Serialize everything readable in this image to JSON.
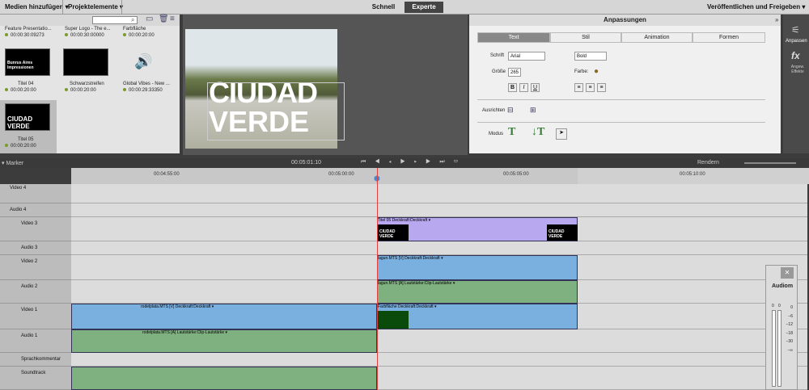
{
  "toolbar": {
    "add_media": "Medien hinzufügen",
    "project_items": "Projektelemente",
    "quick": "Schnell",
    "expert": "Experte",
    "publish": "Veröffentlichen und Freigeben"
  },
  "project": {
    "items": [
      {
        "name": "Feature Presentatio...",
        "time": "00:00:30:09273"
      },
      {
        "name": "Super Logo - The e...",
        "time": "00:00:30:00000"
      },
      {
        "name": "Farbfläche",
        "time": "00:00:20:00"
      },
      {
        "name": "Titel 04",
        "time": "00:00:20:00",
        "thumb_text": "Bunrus Aires Impressionen"
      },
      {
        "name": "Schwarzstreifen",
        "time": "00:00:20:00"
      },
      {
        "name": "Global Vibes - New ...",
        "time": "00:00:29:33350"
      },
      {
        "name": "Titel 05",
        "time": "00:00:20:00",
        "thumb_text": "CIUDAD VERDE"
      }
    ]
  },
  "monitor": {
    "title_line1": "CIUDAD",
    "title_line2": "VERDE"
  },
  "adjust": {
    "header": "Anpassungen",
    "tabs": [
      "Text",
      "Stil",
      "Animation",
      "Formen"
    ],
    "font_label": "Schrift",
    "font_value": "Arial",
    "style_value": "Bold",
    "size_label": "Größe",
    "size_value": "265",
    "color_label": "Farbe:",
    "bold": "B",
    "italic": "I",
    "underline": "U",
    "align_label": "Ausrichten",
    "mode_label": "Modus"
  },
  "rightpanel": {
    "adjust": "Anpassen",
    "effects": "Angew. Effekte"
  },
  "timeline": {
    "marker": "Marker",
    "timecode": "00:05:01:10",
    "render": "Rendern",
    "ticks": [
      "00:04:55:00",
      "00:05:00:00",
      "00:05:05:00",
      "00:05:10:00"
    ]
  },
  "tracks": [
    {
      "name": "Video 4"
    },
    {
      "name": "Audio 4"
    },
    {
      "name": "Video 3"
    },
    {
      "name": "Audio 3"
    },
    {
      "name": "Video 2"
    },
    {
      "name": "Audio 2"
    },
    {
      "name": "Video 1"
    },
    {
      "name": "Audio 1"
    },
    {
      "name": "Sprachkommentar"
    },
    {
      "name": "Soundtrack"
    }
  ],
  "clips": {
    "titel": "Titel 05  Deckkraft:Deckkraft ▾",
    "titel_text": "CIUDAD VERDE",
    "v2": "lagun.MTS [V]  Deckkraft:Deckkraft ▾",
    "a2": "lagun.MTS [A]  Lautstärke:Clip-Lautstärke ▾",
    "v1": "rodelplata.MTS [V]  Deckkraft:Deckkraft ▾",
    "a1": "rodelplata.MTS [A]  Lautstärke:Clip-Lautstärke ▾",
    "farb": "Farbfläche  Deckkraft:Deckkraft ▾"
  },
  "mixer": {
    "title": "Audiom",
    "scale": [
      "0",
      "−6",
      "−12",
      "−18",
      "−30",
      "−∞"
    ],
    "meter_left": "0",
    "meter_right": "0",
    "close": "✕"
  }
}
